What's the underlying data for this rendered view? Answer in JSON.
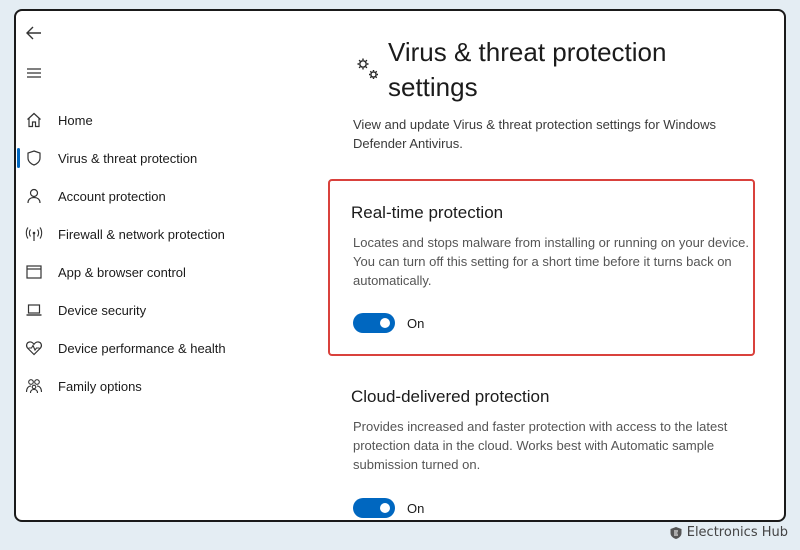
{
  "nav": {
    "back_icon": "arrow-left-icon",
    "menu_icon": "hamburger-icon",
    "items": [
      {
        "label": "Home",
        "icon": "home-icon"
      },
      {
        "label": "Virus & threat protection",
        "icon": "shield-icon",
        "selected": true
      },
      {
        "label": "Account protection",
        "icon": "person-icon"
      },
      {
        "label": "Firewall & network protection",
        "icon": "antenna-icon"
      },
      {
        "label": "App & browser control",
        "icon": "browser-window-icon"
      },
      {
        "label": "Device security",
        "icon": "laptop-icon"
      },
      {
        "label": "Device performance & health",
        "icon": "heart-pulse-icon"
      },
      {
        "label": "Family options",
        "icon": "family-icon"
      }
    ]
  },
  "main": {
    "title": "Virus & threat protection settings",
    "title_icon": "gear-icon",
    "description": "View and update Virus & threat protection settings for Windows Defender Antivirus.",
    "sections": [
      {
        "title": "Real-time protection",
        "description": "Locates and stops malware from installing or running on your device. You can turn off this setting for a short time before it turns back on automatically.",
        "toggle_state": "On",
        "highlighted": true
      },
      {
        "title": "Cloud-delivered protection",
        "description": "Provides increased and faster protection with access to the latest protection data in the cloud. Works best with Automatic sample submission turned on.",
        "toggle_state": "On",
        "highlighted": false
      }
    ]
  },
  "watermark": {
    "text": "Electronics Hub"
  },
  "colors": {
    "accent": "#0067c0",
    "highlight_border": "#d9413c",
    "background": "#e4edf3"
  }
}
